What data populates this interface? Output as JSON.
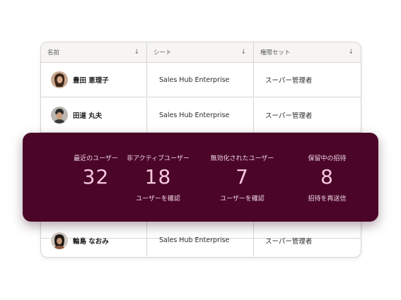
{
  "table": {
    "columns": [
      {
        "label": "名前",
        "sort_icon": "arrow-down-icon"
      },
      {
        "label": "シート",
        "sort_icon": "arrow-down-icon"
      },
      {
        "label": "権限セット",
        "sort_icon": "arrow-down-icon"
      }
    ],
    "rows": [
      {
        "name": "豊田 恵理子",
        "seat": "Sales Hub Enterprise",
        "permission": "スーパー管理者",
        "avatar": "user-avatar"
      },
      {
        "name": "田道 丸夫",
        "seat": "Sales Hub Enterprise",
        "permission": "スーパー管理者",
        "avatar": "user-avatar"
      },
      {
        "name": "輪島 なおみ",
        "seat": "Sales Hub Enterprise",
        "permission": "スーパー管理者",
        "avatar": "user-avatar"
      }
    ]
  },
  "stats": [
    {
      "label": "最近のユーザー",
      "value": "32",
      "link": ""
    },
    {
      "label": "非アクティブユーザー",
      "value": "18",
      "link": "ユーザーを確認"
    },
    {
      "label": "無効化されたユーザー",
      "value": "7",
      "link": "ユーザーを確認"
    },
    {
      "label": "保留中の招待",
      "value": "8",
      "link": "招待を再送信"
    }
  ],
  "colors": {
    "panel_background": "#4a0528",
    "stat_value": "#f6c6dc",
    "stat_text": "#f0d6e2",
    "table_header_bg": "#f6f5f3",
    "border": "#d9d6d2"
  }
}
